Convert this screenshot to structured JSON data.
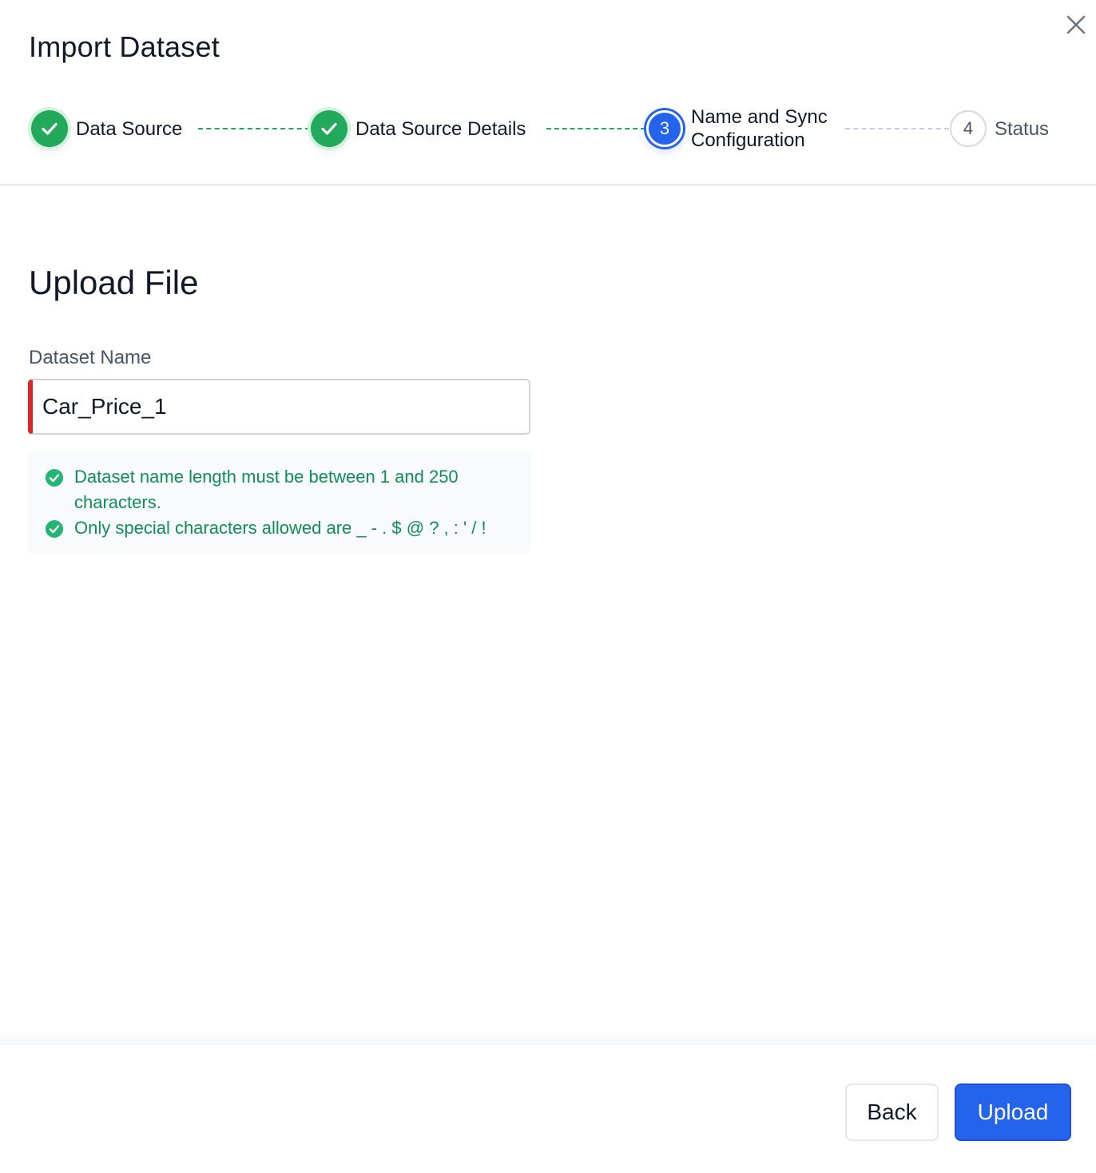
{
  "dialog": {
    "title": "Import Dataset",
    "close_icon": "close-icon"
  },
  "stepper": {
    "steps": [
      {
        "label": "Data Source",
        "state": "completed",
        "icon": "check-icon"
      },
      {
        "label": "Data Source Details",
        "state": "completed",
        "icon": "check-icon"
      },
      {
        "number": "3",
        "label_line1": "Name and Sync",
        "label_line2": "Configuration",
        "state": "active"
      },
      {
        "number": "4",
        "label": "Status",
        "state": "pending"
      }
    ]
  },
  "form": {
    "section_title": "Upload File",
    "dataset_name_label": "Dataset Name",
    "dataset_name_value": "Car_Price_1",
    "rules": [
      {
        "text_line1": "Dataset name length must be between 1 and 250",
        "text_line2": "characters.",
        "icon": "check-circle-icon"
      },
      {
        "text": "Only special characters allowed are _ - . $ @ ? , : ' / !",
        "icon": "check-circle-icon"
      }
    ]
  },
  "footer": {
    "back_label": "Back",
    "upload_label": "Upload"
  },
  "colors": {
    "success": "#22a95c",
    "primary": "#2463eb",
    "error_accent": "#e02424",
    "rule_text": "#0f8f58"
  }
}
